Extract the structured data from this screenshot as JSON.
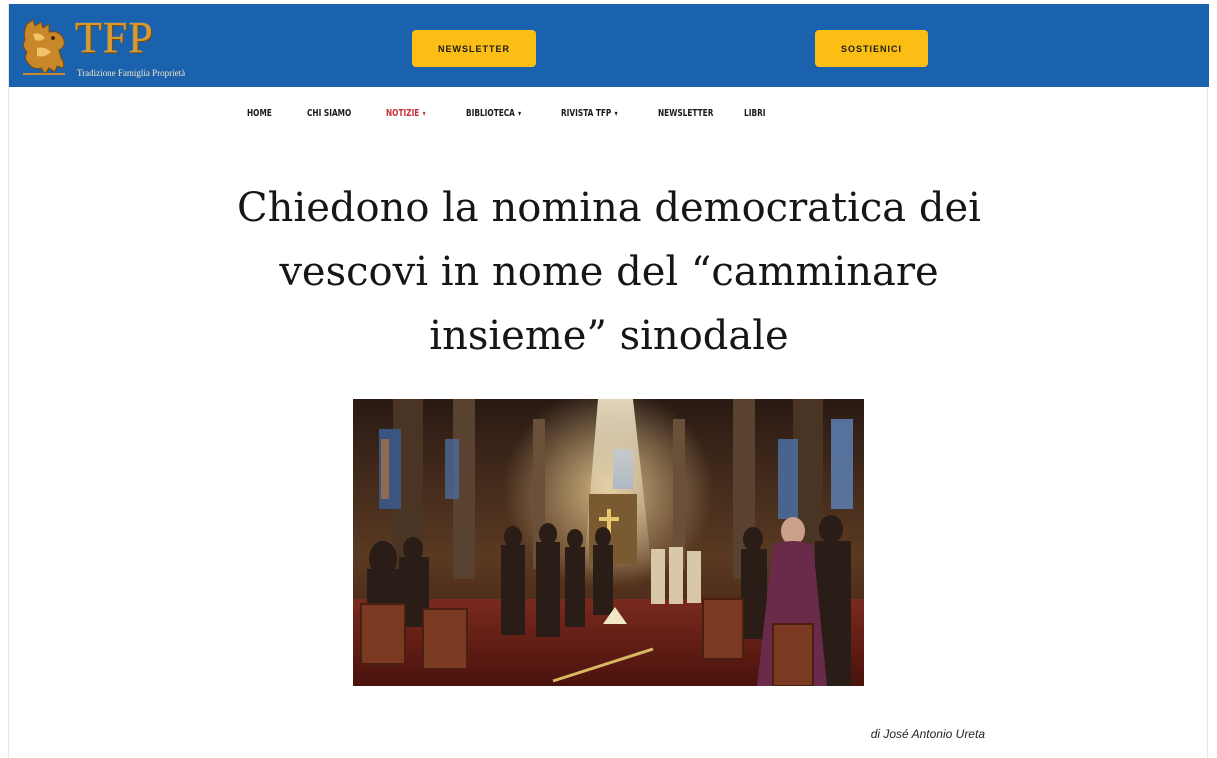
{
  "header": {
    "logo_text": "TFP",
    "logo_tagline": "Tradizione Famiglia Proprietà",
    "newsletter_button": "NEWSLETTER",
    "support_button": "SOSTIENICI",
    "bar_color": "#1b62ae",
    "button_color": "#fbbe14"
  },
  "nav": {
    "items": [
      {
        "label": "HOME",
        "has_dropdown": false
      },
      {
        "label": "CHI SIAMO",
        "has_dropdown": false
      },
      {
        "label": "NOTIZIE",
        "has_dropdown": true,
        "active": true
      },
      {
        "label": "BIBLIOTECA",
        "has_dropdown": true
      },
      {
        "label": "RIVISTA TFP",
        "has_dropdown": true
      },
      {
        "label": "NEWSLETTER",
        "has_dropdown": false
      },
      {
        "label": "LIBRI",
        "has_dropdown": false
      }
    ],
    "caret": "▾",
    "active_color": "#c7303a"
  },
  "article": {
    "title": "Chiedono la nomina democratica dei vescovi in nome del “camminare insieme” sinodale",
    "byline": "di José Antonio Ureta"
  }
}
